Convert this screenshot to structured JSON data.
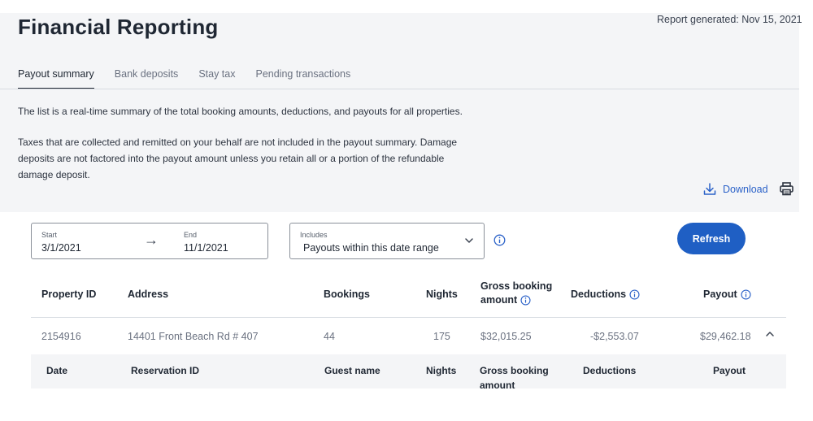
{
  "header": {
    "title": "Financial Reporting",
    "report_generated": "Report generated: Nov 15, 2021"
  },
  "tabs": [
    {
      "label": "Payout summary",
      "active": true
    },
    {
      "label": "Bank deposits",
      "active": false
    },
    {
      "label": "Stay tax",
      "active": false
    },
    {
      "label": "Pending transactions",
      "active": false
    }
  ],
  "description": {
    "line1": "The list is a real-time summary of the total booking amounts, deductions, and payouts for all properties.",
    "line2": "Taxes that are collected and remitted on your behalf are not included in the payout summary. Damage deposits are not factored into the payout amount unless you retain all or a portion of the refundable damage deposit."
  },
  "actions": {
    "download_label": "Download",
    "print_icon": "printer-icon",
    "download_icon": "download-icon"
  },
  "filters": {
    "start_label": "Start",
    "start_value": "3/1/2021",
    "end_label": "End",
    "end_value": "11/1/2021",
    "arrow": "→",
    "includes_label": "Includes",
    "includes_value": "Payouts within this date range",
    "refresh_label": "Refresh"
  },
  "table": {
    "columns": [
      "Property ID",
      "Address",
      "Bookings",
      "Nights",
      "Gross booking amount",
      "Deductions",
      "Payout"
    ],
    "gross_line1": "Gross booking",
    "gross_line2": "amount",
    "rows": [
      {
        "property_id": "2154916",
        "address": "14401 Front Beach Rd # 407",
        "bookings": "44",
        "nights": "175",
        "gross": "$32,015.25",
        "deductions": "-$2,553.07",
        "payout": "$29,462.18",
        "expanded": true
      }
    ],
    "sub_columns": [
      "Date",
      "Reservation ID",
      "Guest name",
      "Nights",
      "Gross booking amount",
      "Deductions",
      "Payout"
    ],
    "sub_gross_line1": "Gross booking",
    "sub_gross_line2": "amount"
  },
  "colors": {
    "accent": "#1f5fc4",
    "link": "#2a61c8",
    "text": "#1f2733",
    "muted": "#6a7180",
    "panel_bg": "#f4f5f7"
  }
}
